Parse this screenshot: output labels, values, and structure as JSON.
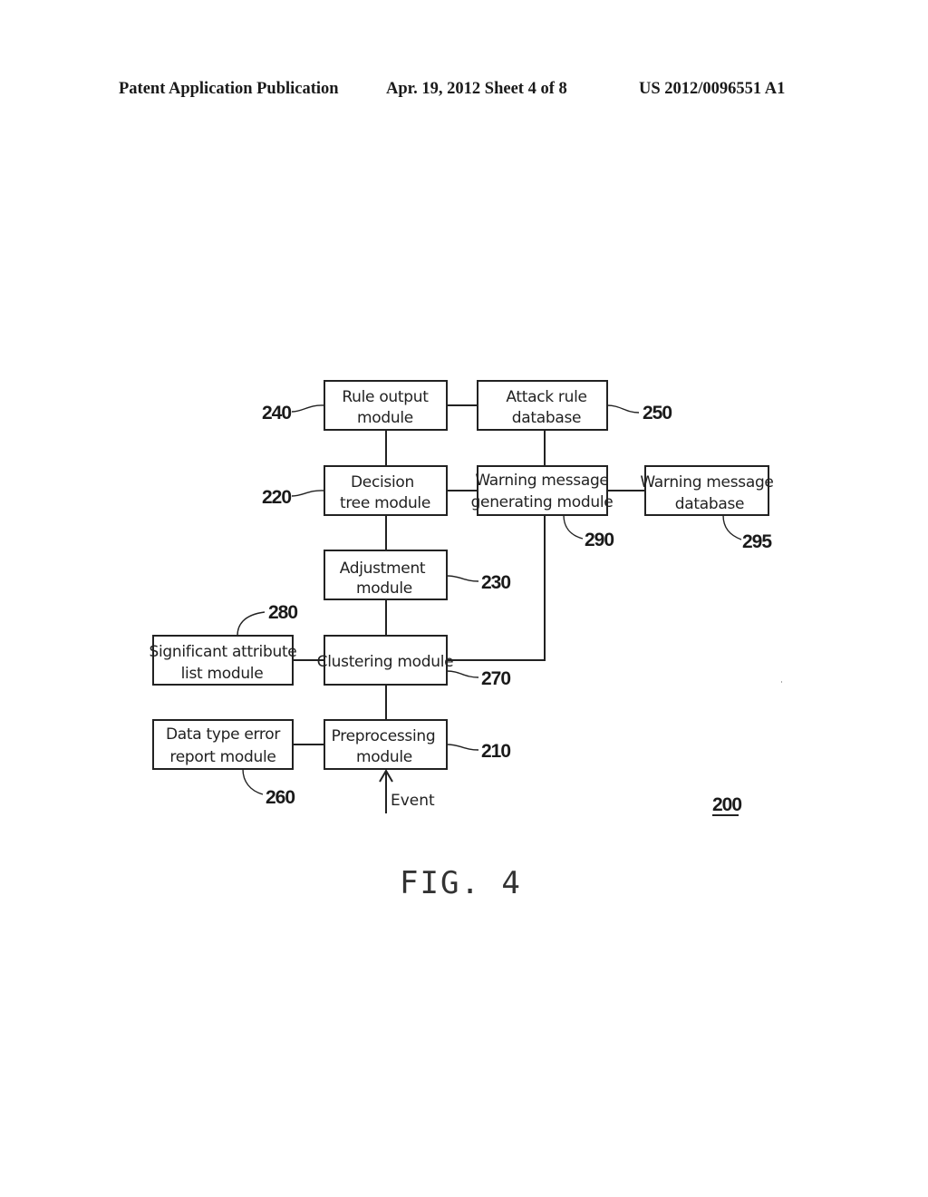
{
  "header": {
    "publication": "Patent Application Publication",
    "date_sheet": "Apr. 19, 2012  Sheet 4 of 8",
    "number": "US 2012/0096551 A1"
  },
  "diagram": {
    "system_ref": "200",
    "figure_label": "FIG. 4",
    "input_label": "Event",
    "modules": {
      "rule_output": {
        "ref": "240",
        "lines": [
          "Rule output",
          "module"
        ]
      },
      "attack_rule_db": {
        "ref": "250",
        "lines": [
          "Attack rule",
          "database"
        ]
      },
      "decision_tree": {
        "ref": "220",
        "lines": [
          "Decision",
          "tree module"
        ]
      },
      "warning_gen": {
        "ref": "290",
        "lines": [
          "Warning message",
          "generating module"
        ]
      },
      "warning_db": {
        "ref": "295",
        "lines": [
          "Warning message",
          "database"
        ]
      },
      "adjustment": {
        "ref": "230",
        "lines": [
          "Adjustment",
          "module"
        ]
      },
      "significant_attr": {
        "ref": "280",
        "lines": [
          "Significant attribute",
          "list module"
        ]
      },
      "clustering": {
        "ref": "270",
        "lines": [
          "Clustering module"
        ]
      },
      "data_type_error": {
        "ref": "260",
        "lines": [
          "Data type error",
          "report module"
        ]
      },
      "preprocessing": {
        "ref": "210",
        "lines": [
          "Preprocessing",
          "module"
        ]
      }
    },
    "connections": [
      [
        "rule_output",
        "attack_rule_db"
      ],
      [
        "rule_output",
        "decision_tree"
      ],
      [
        "attack_rule_db",
        "warning_gen"
      ],
      [
        "decision_tree",
        "warning_gen"
      ],
      [
        "warning_gen",
        "warning_db"
      ],
      [
        "decision_tree",
        "adjustment"
      ],
      [
        "adjustment",
        "clustering"
      ],
      [
        "significant_attr",
        "clustering"
      ],
      [
        "warning_gen",
        "clustering"
      ],
      [
        "clustering",
        "preprocessing"
      ],
      [
        "data_type_error",
        "preprocessing"
      ],
      [
        "event",
        "preprocessing"
      ]
    ]
  }
}
